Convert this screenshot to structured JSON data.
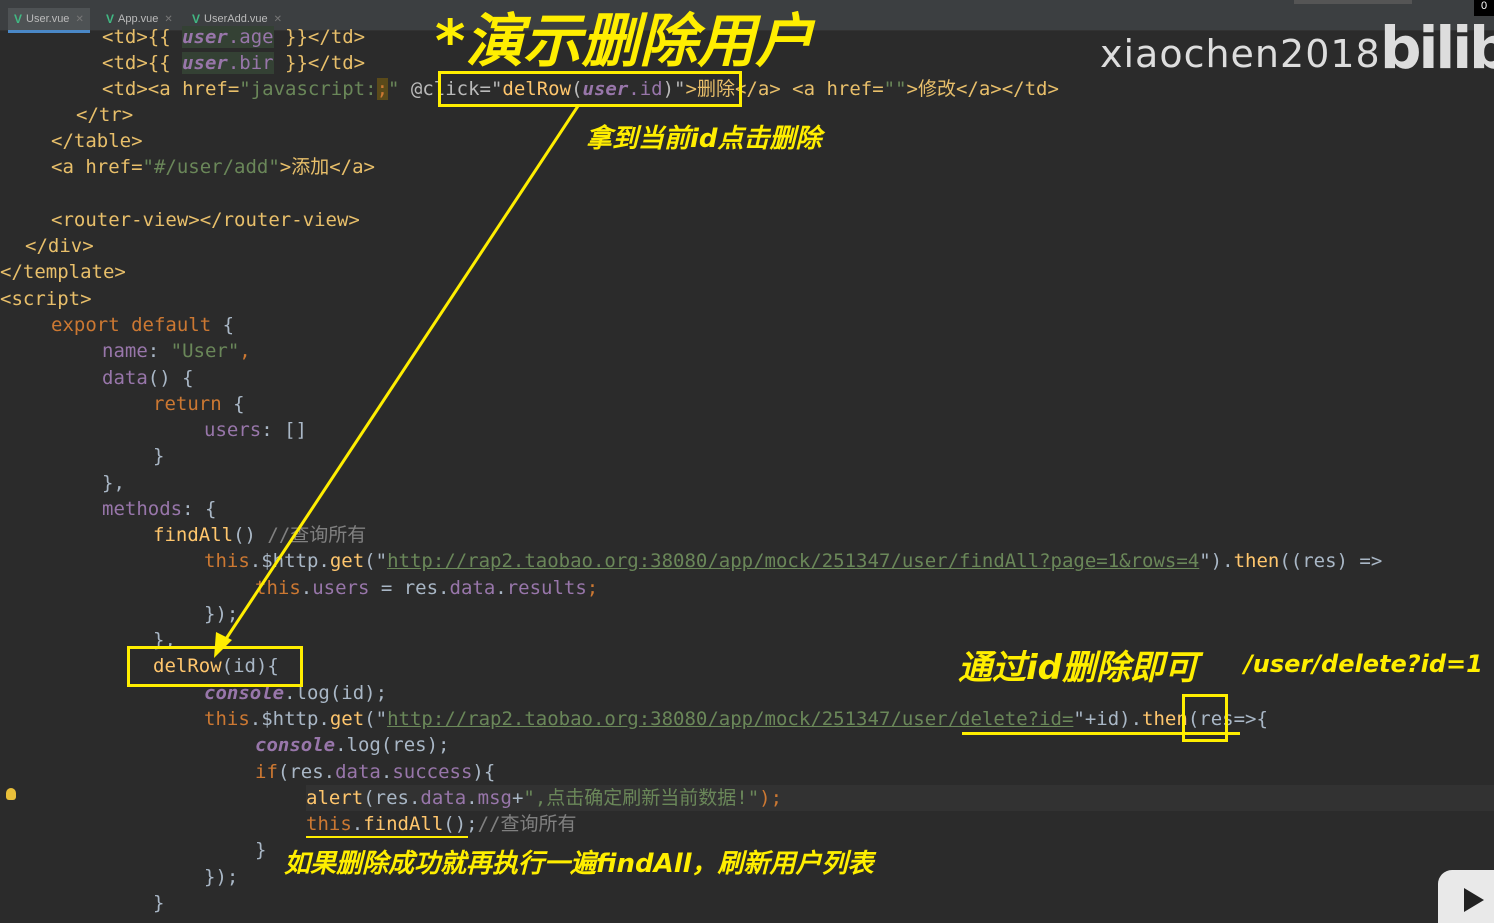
{
  "tabs": [
    {
      "label": "User.vue",
      "active": true
    },
    {
      "label": "App.vue",
      "active": false
    },
    {
      "label": "UserAdd.vue",
      "active": false
    }
  ],
  "corner_text": "0",
  "watermark": "xiaochen2018",
  "logo": "bilibili",
  "annotations": {
    "title": "*演示删除用户",
    "get_id": "拿到当前id点击删除",
    "delete_by_id": "通过id删除即可",
    "delete_path": "/user/delete?id=1",
    "refresh": "如果删除成功就再执行一遍findAll，刷新用户列表"
  },
  "code": {
    "l1": {
      "a": "<td>{{ ",
      "b": "user",
      "c": ".age",
      "d": " }}</td>"
    },
    "l2": {
      "a": "<td>{{ ",
      "b": "user",
      "c": ".bir",
      "d": " }}</td>"
    },
    "l3": {
      "a": "<td><a href=",
      "b": "\"javascript:",
      "c": ";",
      "d": "\" ",
      "e": "@click=\"",
      "f": "delRow",
      "g": "(",
      "h": "user",
      "i": ".id",
      "j": ")\"",
      "k": ">删除</a> <a href=",
      "l": "\"\"",
      "m": ">修改</a></td>"
    },
    "l4": "</tr>",
    "l5": "</table>",
    "l6": {
      "a": "<a href=",
      "b": "\"#/user/add\"",
      "c": ">添加</a>"
    },
    "l7": "<router-view></router-view>",
    "l8": "</div>",
    "l9": "</template>",
    "l10": "<script>",
    "l11": {
      "a": "export default",
      "b": " {"
    },
    "l12": {
      "a": "name",
      "b": ": ",
      "c": "\"User\"",
      "d": ","
    },
    "l13": {
      "a": "data",
      "b": "() {"
    },
    "l14": {
      "a": "return",
      "b": " {"
    },
    "l15": {
      "a": "users",
      "b": ": []"
    },
    "l16": "}",
    "l17": "},",
    "l18": {
      "a": "methods",
      "b": ": {"
    },
    "l19": {
      "a": "findAll",
      "b": "() ",
      "c": "//查询所有"
    },
    "l20": {
      "a": "this",
      "b": ".$http.",
      "c": "get",
      "d": "(\"",
      "e": "http://rap2.taobao.org:38080/app/mock/251347/user/findAll?page=1&rows=4",
      "f": "\").",
      "g": "then",
      "h": "((res) =>"
    },
    "l21": {
      "a": "this",
      "b": ".",
      "c": "users",
      "d": " = res.",
      "e": "data",
      "f": ".",
      "g": "results",
      "h": ";"
    },
    "l22": "});",
    "l23": "},",
    "l24": {
      "a": "delRow",
      "b": "(id){"
    },
    "l25": {
      "a": "console",
      "b": ".log(id);"
    },
    "l26": {
      "a": "this",
      "b": ".$http.",
      "c": "get",
      "d": "(\"",
      "e": "http://rap2.taobao.org:38080/app/mock/251347/user/delete?id=",
      "f": "\"+id).",
      "g": "then",
      "h": "(res=>{"
    },
    "l27": {
      "a": "console",
      "b": ".log(res);"
    },
    "l28": {
      "a": "if",
      "b": "(res.",
      "c": "data",
      "d": ".",
      "e": "success",
      "f": "){"
    },
    "l29": {
      "a": "alert",
      "b": "(res.",
      "c": "data",
      "d": ".",
      "e": "msg",
      "f": "+",
      "g": "\",点击确定刷新当前数据!\"",
      "h": ");"
    },
    "l30": {
      "a": "this",
      "b": ".",
      "c": "findAll",
      "d": "();",
      "e": "//查询所有"
    },
    "l31": "}",
    "l32": "});",
    "l33": "}"
  },
  "colors": {
    "annotation": "#ffee00",
    "background": "#2b2b2b",
    "tab_accent": "#4a88c7",
    "vue_icon": "#41b883"
  }
}
